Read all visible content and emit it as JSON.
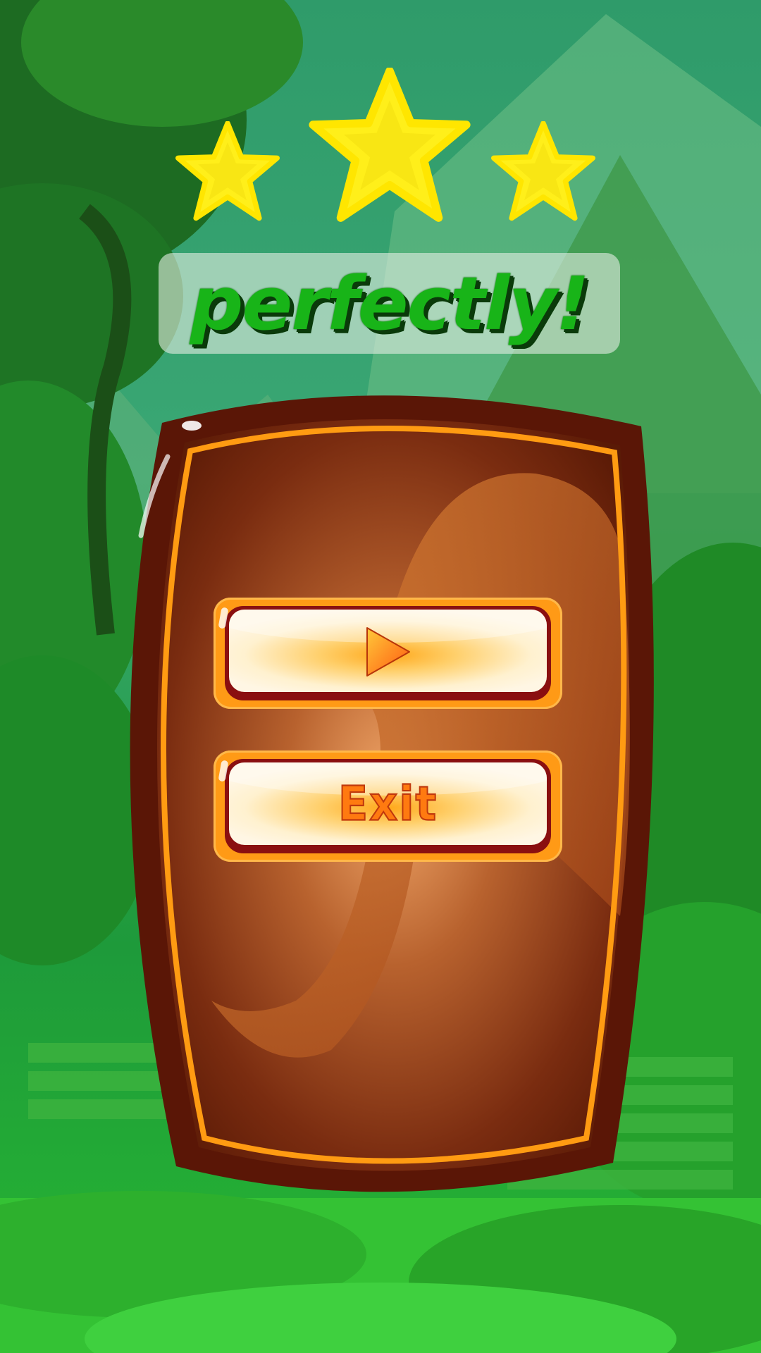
{
  "stars": {
    "earned": 3,
    "total": 3
  },
  "title": {
    "text": "perfectly!"
  },
  "buttons": {
    "play_icon": "play-icon",
    "exit_label": "Exit"
  },
  "colors": {
    "star": "#ffef1a",
    "title_green": "#18b418",
    "board_brown": "#5a1a06",
    "board_rim": "#ff9b12",
    "button_orange": "#ff9a16",
    "button_rim": "#8a0f10"
  }
}
